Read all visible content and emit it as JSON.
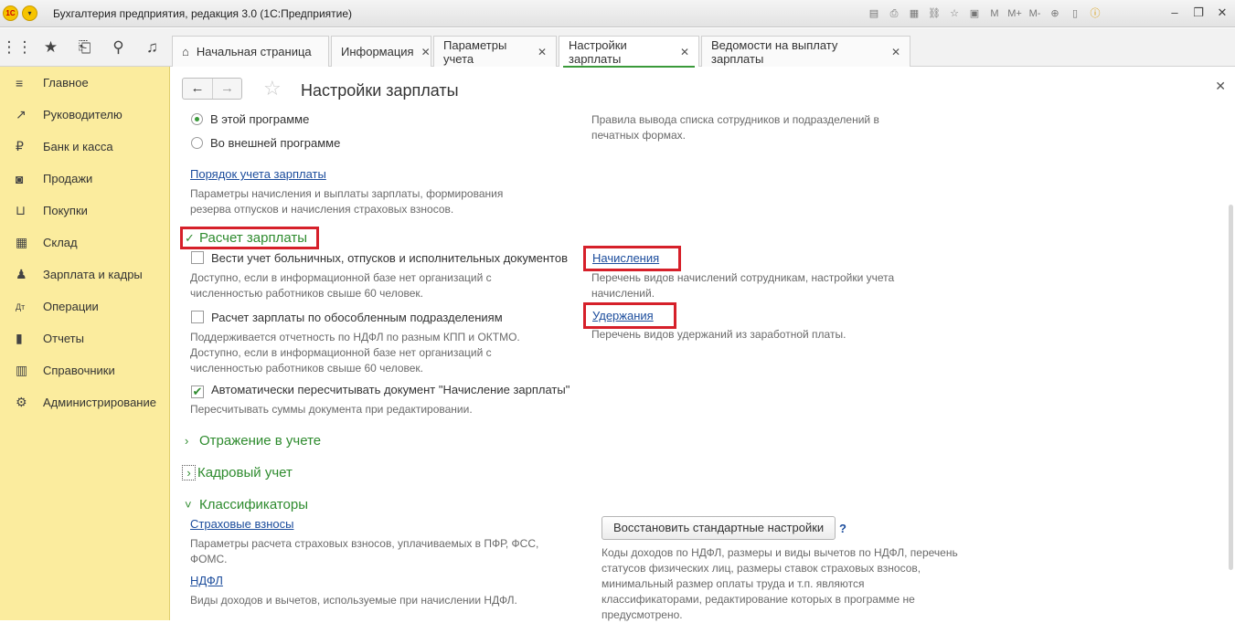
{
  "window": {
    "title": "Бухгалтерия предприятия, редакция 3.0  (1С:Предприятие)",
    "logo_text": "1С",
    "toolbar_icons": [
      "save-icon",
      "print-icon",
      "preview-icon",
      "link-icon",
      "favorites-icon",
      "calendar-icon",
      "memory-m-icon",
      "memory-mplus-icon",
      "memory-mminus-icon",
      "zoom-icon",
      "panel-icon",
      "info-icon"
    ],
    "toolbar_labels": {
      "m": "M",
      "mplus": "M+",
      "mminus": "M-"
    }
  },
  "tabs": [
    {
      "label": "Начальная страница",
      "closable": false,
      "active": false
    },
    {
      "label": "Информация",
      "closable": true,
      "active": false
    },
    {
      "label": "Параметры учета",
      "closable": true,
      "active": false
    },
    {
      "label": "Настройки зарплаты",
      "closable": true,
      "active": true
    },
    {
      "label": "Ведомости на выплату зарплаты",
      "closable": true,
      "active": false
    }
  ],
  "sidebar": {
    "items": [
      {
        "label": "Главное",
        "icon": "menu-icon"
      },
      {
        "label": "Руководителю",
        "icon": "trend-icon"
      },
      {
        "label": "Банк и касса",
        "icon": "ruble-icon"
      },
      {
        "label": "Продажи",
        "icon": "bag-icon"
      },
      {
        "label": "Покупки",
        "icon": "cart-icon"
      },
      {
        "label": "Склад",
        "icon": "warehouse-icon"
      },
      {
        "label": "Зарплата и кадры",
        "icon": "person-icon"
      },
      {
        "label": "Операции",
        "icon": "dt-kt-icon"
      },
      {
        "label": "Отчеты",
        "icon": "bar-chart-icon"
      },
      {
        "label": "Справочники",
        "icon": "book-icon"
      },
      {
        "label": "Администрирование",
        "icon": "gear-icon"
      }
    ]
  },
  "form": {
    "title": "Настройки зарплаты",
    "radio_in_program": "В этой программе",
    "radio_external": "Во внешней программе",
    "print_rules_desc": "Правила вывода списка сотрудников и подразделений в печатных формах.",
    "salary_order_link": "Порядок учета зарплаты",
    "salary_order_desc": "Параметры начисления и выплаты зарплаты, формирования резерва отпусков и начисления страховых взносов.",
    "group_calc": "Расчет зарплаты",
    "cb_sick_leave": "Вести учет больничных, отпусков и исполнительных документов",
    "cb_sick_leave_desc": "Доступно, если в информационной базе нет организаций с численностью работников свыше 60 человек.",
    "cb_separate": "Расчет зарплаты по обособленным подразделениям",
    "cb_separate_desc": "Поддерживается отчетность по НДФЛ по разным КПП и ОКТМО. Доступно, если в информационной базе нет организаций с численностью работников свыше 60 человек.",
    "cb_auto_recalc": "Автоматически пересчитывать документ \"Начисление зарплаты\"",
    "cb_auto_recalc_desc": "Пересчитывать суммы документа при редактировании.",
    "accruals_link": "Начисления",
    "accruals_desc": "Перечень видов начислений сотрудникам, настройки учета начислений.",
    "deductions_link": "Удержания",
    "deductions_desc": "Перечень видов удержаний из заработной платы.",
    "group_reflection": "Отражение в учете",
    "group_hr": "Кадровый учет",
    "group_classifiers": "Классификаторы",
    "insurance_link": "Страховые взносы",
    "insurance_desc": "Параметры расчета страховых взносов, уплачиваемых в ПФР, ФСС, ФОМС.",
    "ndfl_link": "НДФЛ",
    "ndfl_desc": "Виды доходов и вычетов, используемые при начислении НДФЛ.",
    "restore_button": "Восстановить стандартные настройки",
    "help_mark": "?",
    "classifiers_desc": "Коды доходов по НДФЛ, размеры и виды вычетов по НДФЛ, перечень статусов физических лиц, размеры ставок страховых взносов, минимальный размер оплаты труда и т.п. являются классификаторами, редактирование которых в программе не предусмотрено."
  }
}
